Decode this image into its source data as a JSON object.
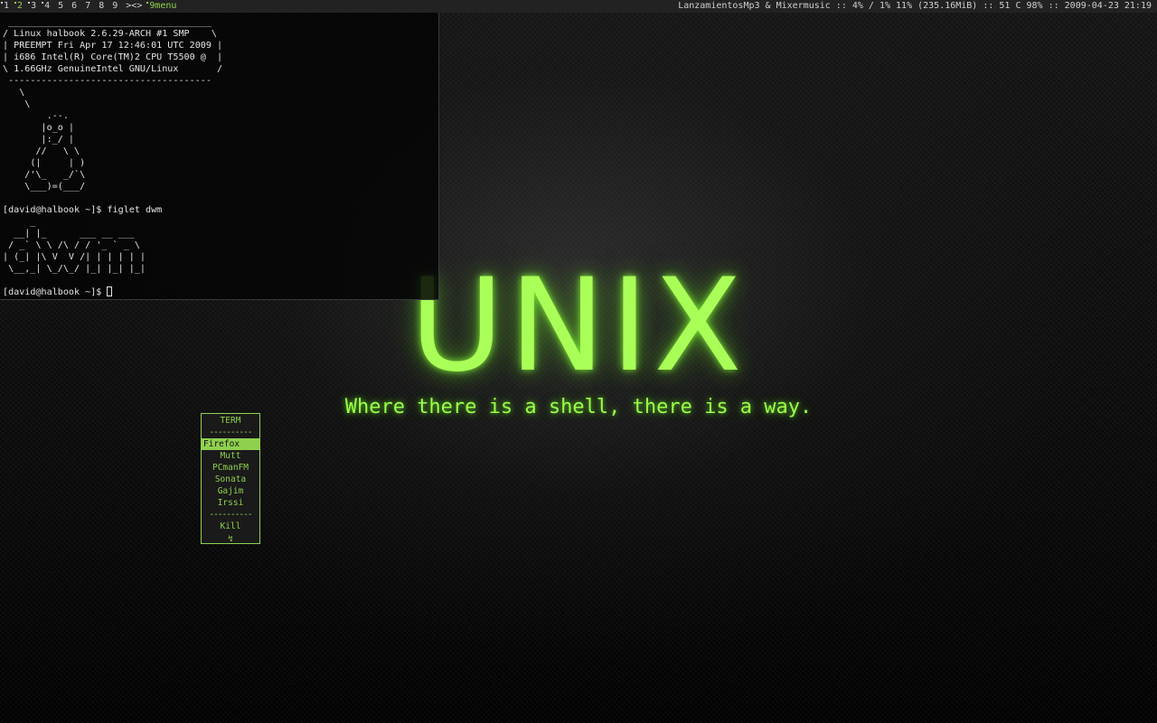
{
  "statusbar": {
    "tags": [
      {
        "label": "1",
        "occupied": true,
        "selected": false
      },
      {
        "label": "2",
        "occupied": true,
        "selected": true
      },
      {
        "label": "3",
        "occupied": true,
        "selected": false
      },
      {
        "label": "4",
        "occupied": true,
        "selected": false
      },
      {
        "label": "5",
        "occupied": false,
        "selected": false
      },
      {
        "label": "6",
        "occupied": false,
        "selected": false
      },
      {
        "label": "7",
        "occupied": false,
        "selected": false
      },
      {
        "label": "8",
        "occupied": false,
        "selected": false
      },
      {
        "label": "9",
        "occupied": false,
        "selected": false
      }
    ],
    "layout_symbol": "><>",
    "menu_label": "9menu",
    "status_text": "LanzamientosMp3 & Mixermusic :: 4% / 1% 11% (235.16MiB) :: 51 C 98% :: 2009-04-23 21:19"
  },
  "terminal": {
    "lines": [
      " _____________________________________ ",
      "/ Linux halbook 2.6.29-ARCH #1 SMP    \\",
      "| PREEMPT Fri Apr 17 12:46:01 UTC 2009 |",
      "| i686 Intel(R) Core(TM)2 CPU T5500 @  |",
      "\\ 1.66GHz GenuineIntel GNU/Linux       /",
      " -------------------------------------",
      "   \\",
      "    \\",
      "        .--.",
      "       |o_o |",
      "       |:_/ |",
      "      //   \\ \\",
      "     (|     | )",
      "    /'\\_   _/`\\",
      "    \\___)=(___/",
      "",
      "[david@halbook ~]$ figlet dwm",
      "     _",
      "  __| |_      ___ __ ___",
      " / _` \\ \\ /\\ / / '_ ` _ \\",
      "| (_| |\\ V  V /| | | | | |",
      " \\__,_| \\_/\\_/ |_| |_| |_|",
      "",
      "[david@halbook ~]$ "
    ]
  },
  "wallpaper": {
    "logo_text": "UNIX",
    "slogan": "Where there is a shell, there is a way.",
    "accent_color": "#a9ff57"
  },
  "popup_menu": {
    "title": "TERM",
    "separator": "----------",
    "items": [
      "Firefox",
      "Mutt",
      "PCmanFM",
      "Sonata",
      "Gajim",
      "Irssi"
    ],
    "active_item": "Firefox",
    "kill_label": "Kill",
    "bottom_glyph": "↯",
    "border_color": "#8fd14f"
  }
}
